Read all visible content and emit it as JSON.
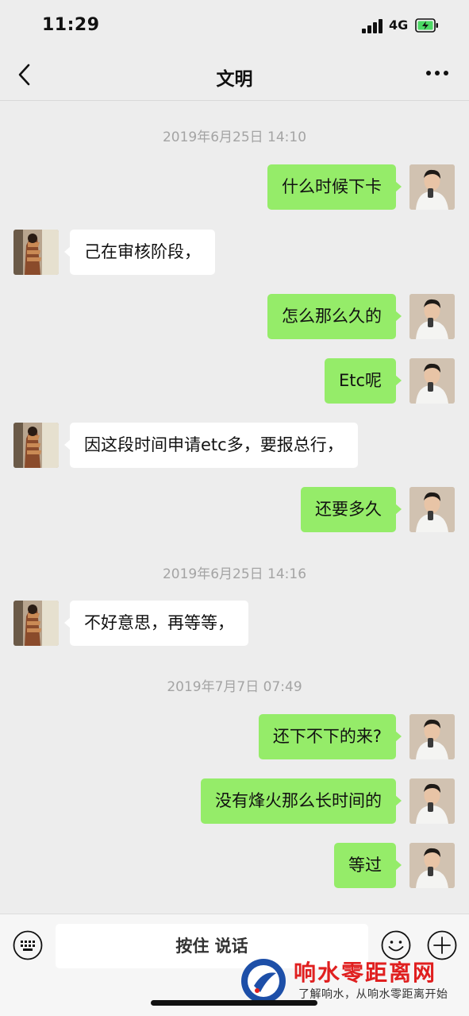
{
  "status_bar": {
    "time": "11:29",
    "network": "4G"
  },
  "nav": {
    "title": "文明"
  },
  "timestamps": [
    "2019年6月25日 14:10",
    "2019年6月25日 14:16",
    "2019年7月7日 07:49"
  ],
  "messages": [
    {
      "side": "out",
      "text": "什么时候下卡"
    },
    {
      "side": "in",
      "text": "己在审核阶段，"
    },
    {
      "side": "out",
      "text": "怎么那么久的"
    },
    {
      "side": "out",
      "text": "Etc呢"
    },
    {
      "side": "in",
      "text": "因这段时间申请etc多，要报总行，"
    },
    {
      "side": "out",
      "text": "还要多久"
    },
    {
      "side": "in",
      "text": "不好意思，再等等，"
    },
    {
      "side": "out",
      "text": "还下不下的来?"
    },
    {
      "side": "out",
      "text": "没有烽火那么长时间的"
    },
    {
      "side": "out",
      "text": "等过"
    }
  ],
  "input_bar": {
    "hold_to_talk": "按住 说话"
  },
  "watermark": {
    "title": "响水零距离网",
    "subtitle": "了解响水，从响水零距离开始"
  },
  "colors": {
    "outgoing_bubble": "#95ec69",
    "incoming_bubble": "#ffffff",
    "background": "#ededed",
    "watermark_red": "#e01f1f"
  },
  "icons": [
    "back-icon",
    "more-icon",
    "keyboard-icon",
    "emoji-icon",
    "plus-icon",
    "signal-icon",
    "battery-charging-icon"
  ]
}
